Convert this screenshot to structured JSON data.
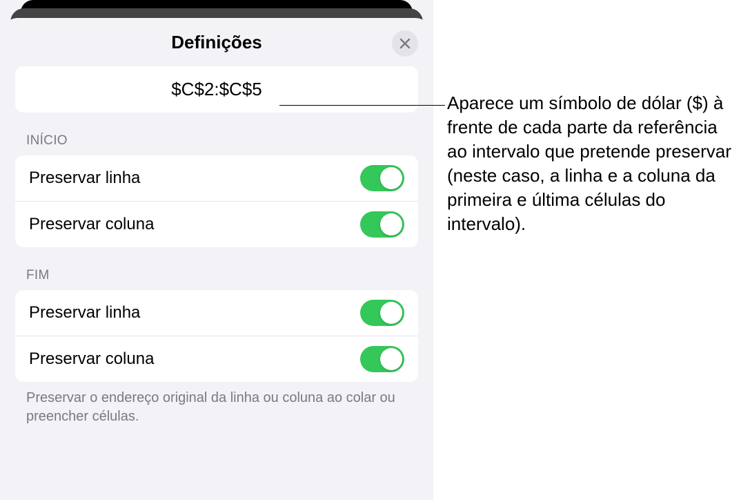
{
  "sheet": {
    "title": "Definições",
    "reference": "$C$2:$C$5",
    "sections": {
      "start": {
        "header": "INÍCIO",
        "preserve_row": "Preservar linha",
        "preserve_column": "Preservar coluna"
      },
      "end": {
        "header": "FIM",
        "preserve_row": "Preservar linha",
        "preserve_column": "Preservar coluna"
      }
    },
    "footer": "Preservar o endereço original da linha ou coluna ao colar ou preencher células."
  },
  "callout": "Aparece um símbolo de dólar ($) à frente de cada parte da referência ao intervalo que pretende preservar (neste caso, a linha e a coluna da primeira e última células do intervalo)."
}
